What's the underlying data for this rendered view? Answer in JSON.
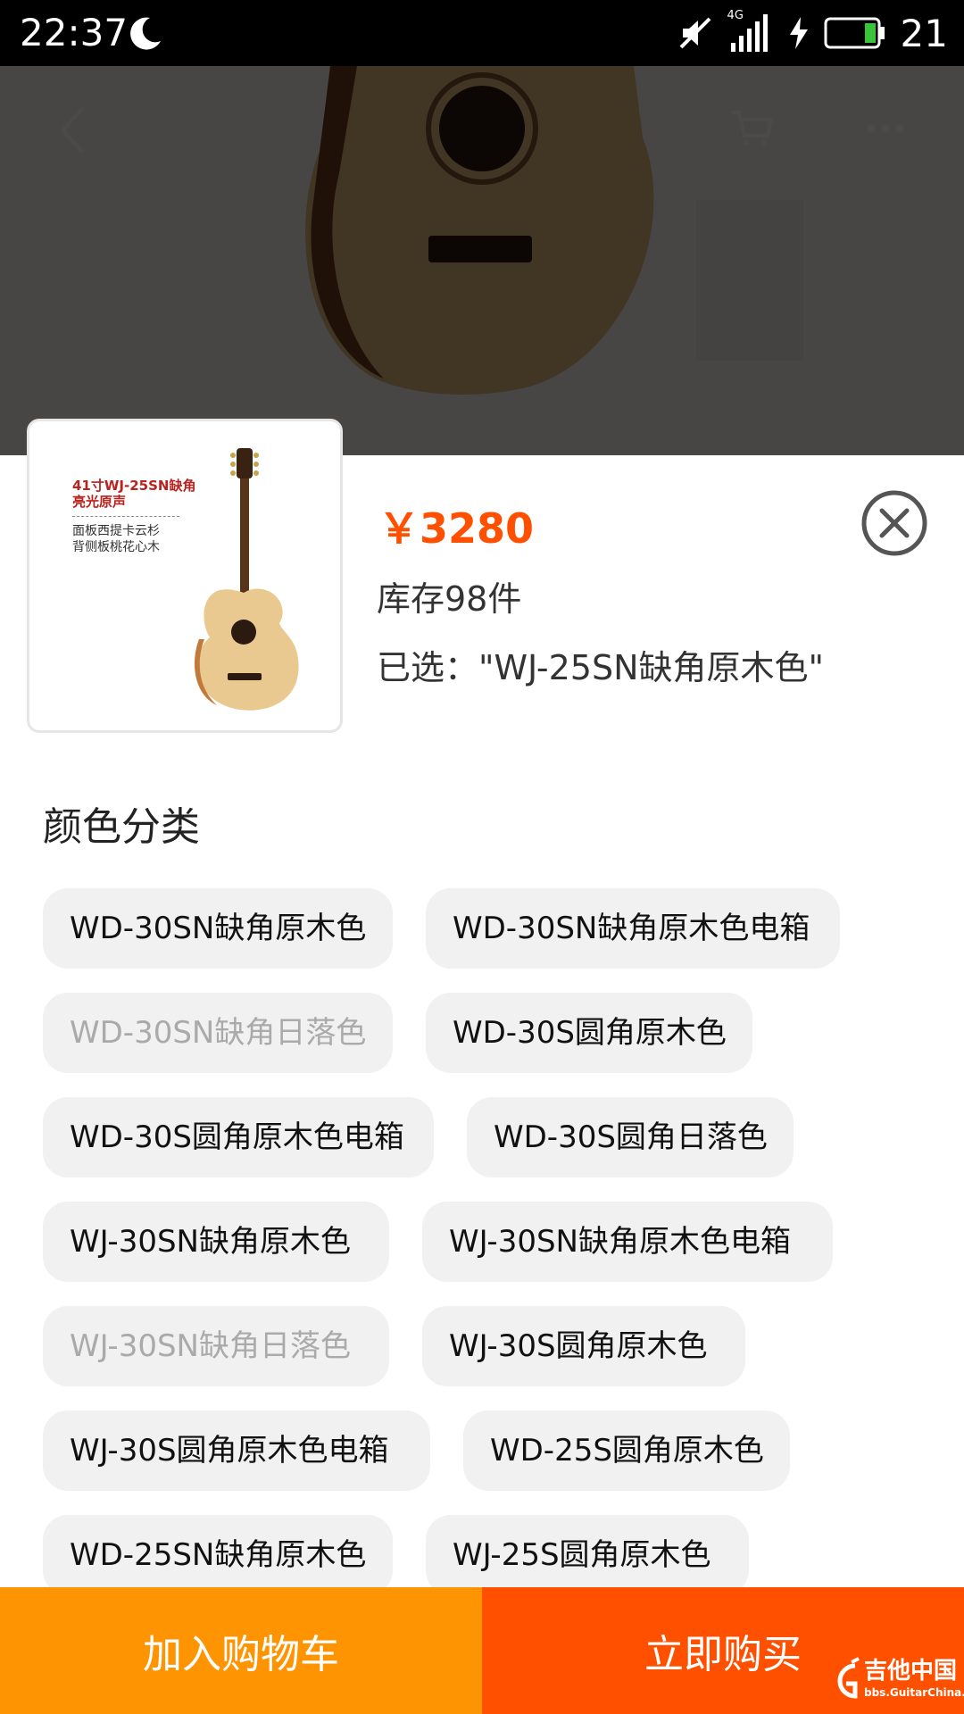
{
  "status_bar": {
    "time": "22:37",
    "network": "4G",
    "battery_level": "21"
  },
  "product": {
    "price": "￥3280",
    "stock": "库存98件",
    "selected": "已选：\"WJ-25SN缺角原木色\"",
    "thumbnail_title_line1": "41寸WJ-25SN缺角",
    "thumbnail_title_line2": "亮光原声",
    "thumbnail_desc_line1": "面板西提卡云杉",
    "thumbnail_desc_line2": "背侧板桃花心木"
  },
  "color_section": {
    "title": "颜色分类",
    "options": [
      {
        "label": "WD-30SN缺角原木色",
        "available": true
      },
      {
        "label": "WD-30SN缺角原木色电箱",
        "available": true
      },
      {
        "label": "WD-30SN缺角日落色",
        "available": false
      },
      {
        "label": "WD-30S圆角原木色",
        "available": true
      },
      {
        "label": "WD-30S圆角原木色电箱",
        "available": true
      },
      {
        "label": "WD-30S圆角日落色",
        "available": true
      },
      {
        "label": "WJ-30SN缺角原木色",
        "available": true
      },
      {
        "label": "WJ-30SN缺角原木色电箱",
        "available": true
      },
      {
        "label": "WJ-30SN缺角日落色",
        "available": false
      },
      {
        "label": "WJ-30S圆角原木色",
        "available": true
      },
      {
        "label": "WJ-30S圆角原木色电箱",
        "available": true
      },
      {
        "label": "WD-25S圆角原木色",
        "available": true
      },
      {
        "label": "WD-25SN缺角原木色",
        "available": true
      },
      {
        "label": "WJ-25S圆角原木色",
        "available": true
      }
    ]
  },
  "actions": {
    "add_to_cart": "加入购物车",
    "buy_now": "立即购买"
  },
  "watermark": {
    "line1": "吉他中国",
    "line2": "bbs.GuitarChina.com"
  },
  "colors": {
    "price": "#ff5000",
    "add_to_cart_bg": "#ff9402",
    "buy_now_bg": "#ff5000",
    "chip_bg": "#f1f1f1"
  }
}
